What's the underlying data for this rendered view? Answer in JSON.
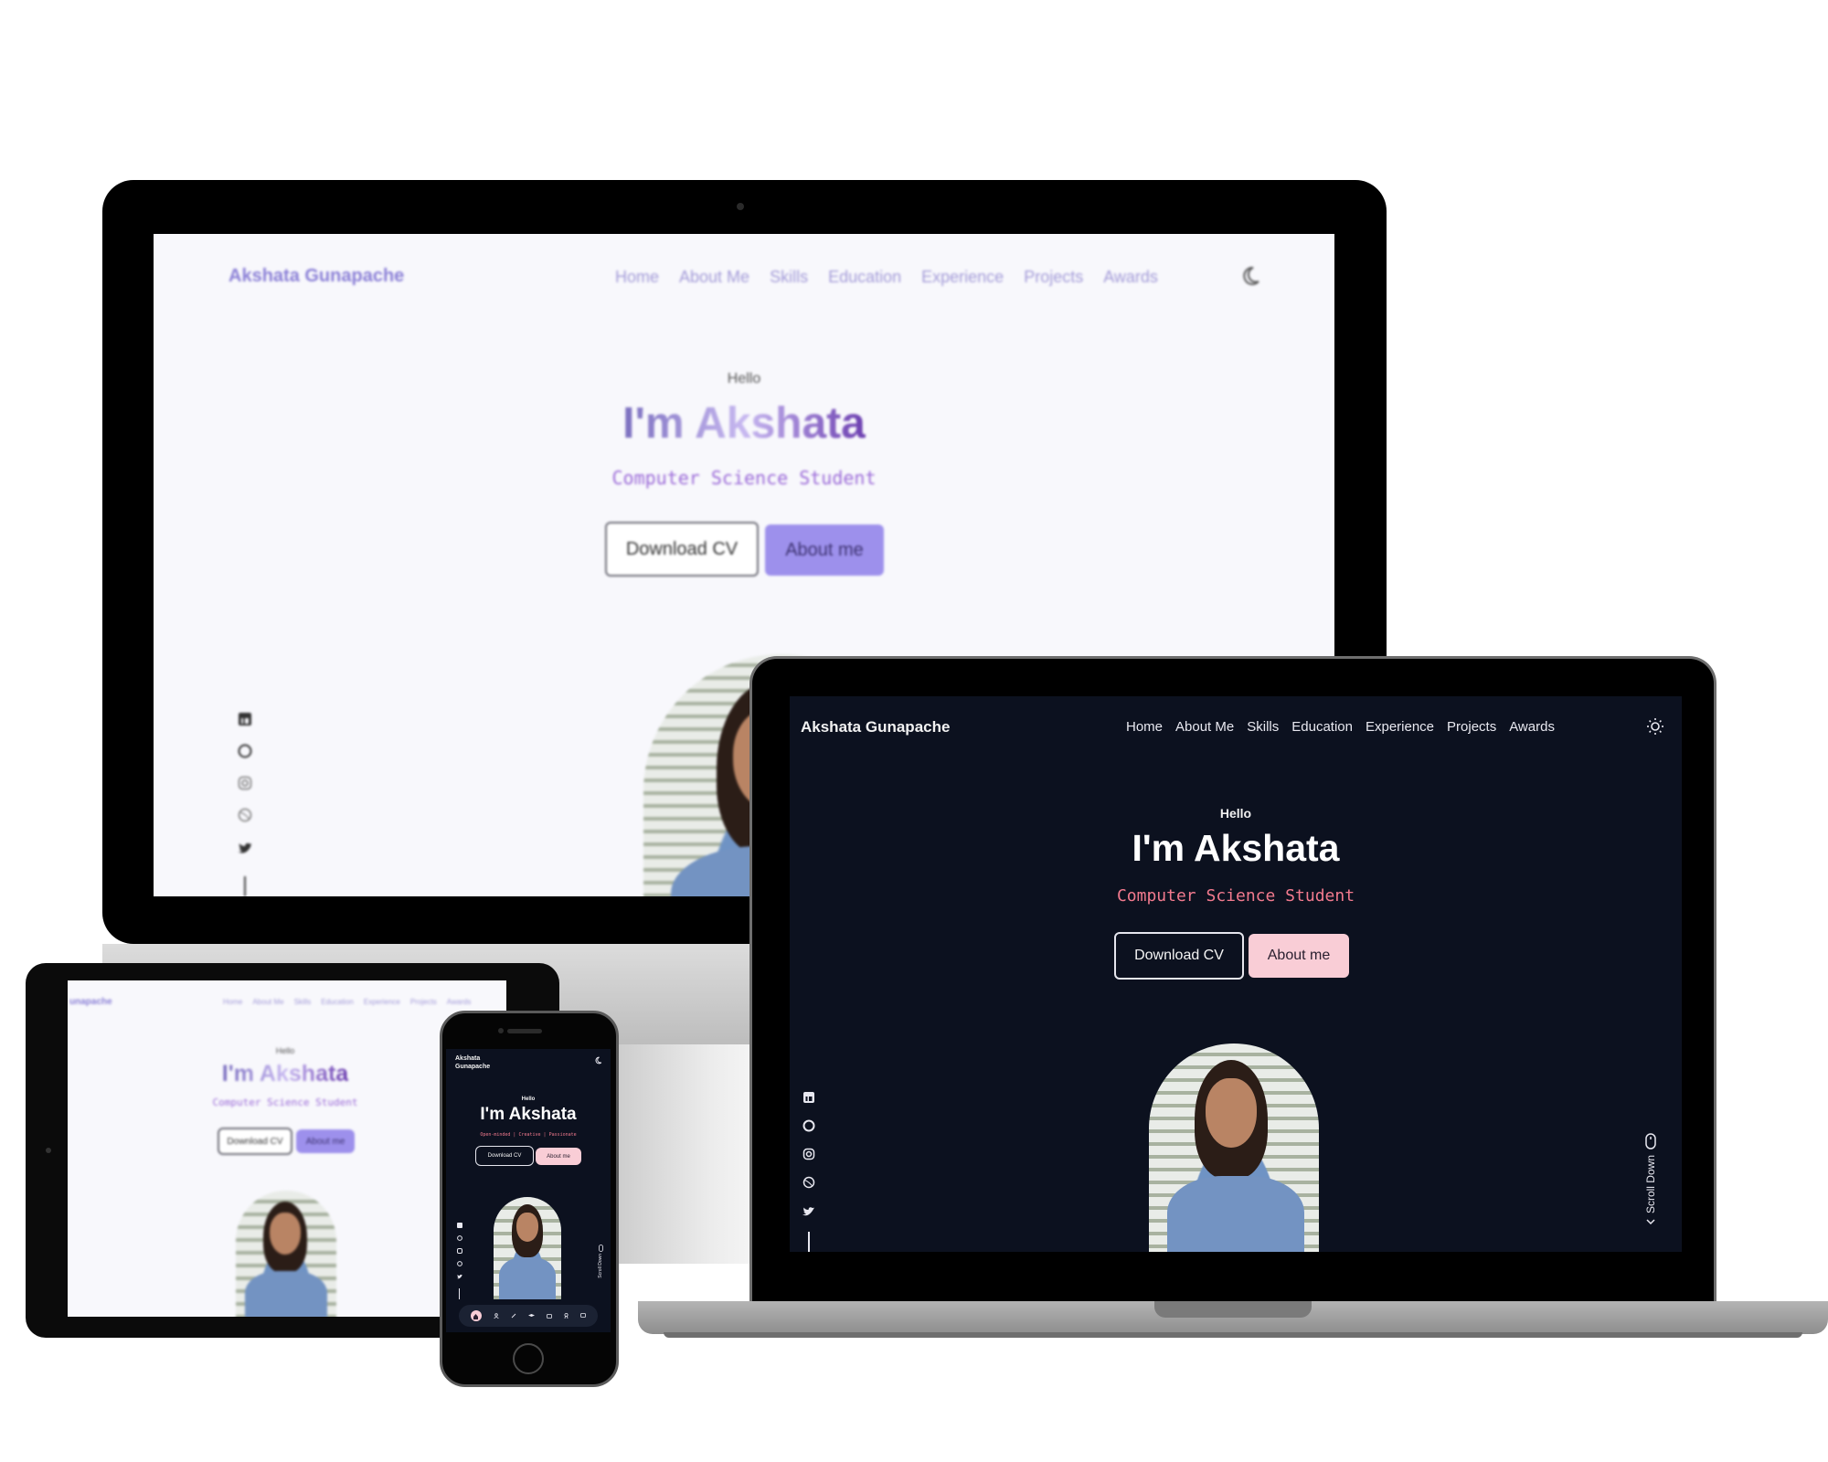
{
  "site": {
    "brand": "Akshata Gunapache",
    "brand_phone_line1": "Akshata",
    "brand_phone_line2": "Gunapache",
    "brand_tablet_partial": "unapache",
    "nav": [
      "Home",
      "About Me",
      "Skills",
      "Education",
      "Experience",
      "Projects",
      "Awards"
    ],
    "hello": "Hello",
    "title": "I'm Akshata",
    "subtitle": "Computer Science Student",
    "phone_subtitle": "Open-minded | Creative | Passionate",
    "download_cv": "Download CV",
    "about_me": "About me",
    "scroll_down": "Scroll Down"
  },
  "icons": {
    "social": [
      "linkedin-icon",
      "github-icon",
      "instagram-icon",
      "dribbble-icon",
      "twitter-icon"
    ],
    "theme_light_mode": "moon-icon",
    "theme_dark_mode": "sun-icon",
    "phone_dock": [
      "home-icon",
      "user-icon",
      "tools-icon",
      "graduation-icon",
      "briefcase-icon",
      "award-icon",
      "message-icon"
    ]
  },
  "colors": {
    "light_bg": "#f8f8fc",
    "light_accent": "#9d90ec",
    "dark_bg": "#0c111f",
    "dark_accent": "#f9cdd6",
    "dark_subtitle": "#f27a8e"
  }
}
